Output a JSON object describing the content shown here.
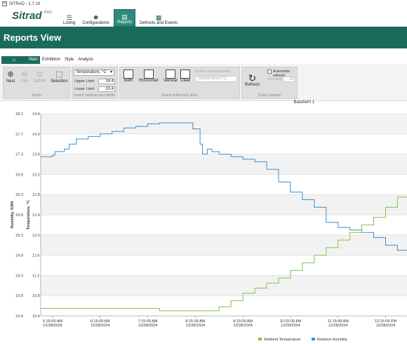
{
  "window": {
    "title": "SITRAD - 1.7.19"
  },
  "logo": {
    "brand": "Sitrad",
    "suffix": "PRO"
  },
  "topnav": {
    "items": [
      {
        "label": "Listing",
        "icon": "list-icon"
      },
      {
        "label": "Configurations",
        "icon": "gear-icon"
      },
      {
        "label": "Reports",
        "icon": "report-icon"
      },
      {
        "label": "Defrosts and Events",
        "icon": "calendar-icon"
      }
    ]
  },
  "header": {
    "title": "Reports View"
  },
  "tabs": {
    "home": "⌂",
    "items": [
      "Main",
      "Exhibition",
      "Style",
      "Analyze"
    ]
  },
  "ribbon": {
    "zoom": {
      "label": "Zoom",
      "next": "Next",
      "out": "Out",
      "pct": "100 %",
      "selection": "Selection"
    },
    "axis": {
      "label": "Insert vertical axis limits",
      "select": "Temperature, °C",
      "upper_label": "Upper Limit",
      "upper_value": "14.4",
      "lower_label": "Lower Limit",
      "lower_value": "10.4"
    },
    "reflines": {
      "label": "Insert reference lines",
      "both": "Both",
      "horizontal": "Horizontal",
      "vertical": "Vertical",
      "clear": "Clear",
      "select_label": "Select measurement",
      "select_value": "Temperature,°C"
    },
    "update": {
      "label": "Chart Update",
      "refresh": "Refresh",
      "auto": "Automatic refresh",
      "seconds_label": "Seconds",
      "seconds_value": "10"
    }
  },
  "sensor_label": "BalaSefri 1",
  "chart_data": {
    "type": "line",
    "ylabel_left": "Humidity, %RH",
    "ylabel_right": "Temperature, °C",
    "left_ticks": [
      "28.2",
      "27.7",
      "27.3",
      "26.8",
      "26.3",
      "25.8",
      "25.3",
      "24.8",
      "24.3",
      "23.8",
      "23.4"
    ],
    "right_ticks": [
      "14.4",
      "14.0",
      "13.6",
      "13.2",
      "12.8",
      "12.4",
      "12.0",
      "11.6",
      "11.2",
      "10.8",
      "10.4"
    ],
    "x_ticks": [
      {
        "time": "5:15:09 AM",
        "date": "12/28/2024"
      },
      {
        "time": "6:15:09 AM",
        "date": "12/28/2024"
      },
      {
        "time": "7:15:09 AM",
        "date": "12/28/2024"
      },
      {
        "time": "8:15:09 AM",
        "date": "12/28/2024"
      },
      {
        "time": "9:15:09 AM",
        "date": "12/28/2024"
      },
      {
        "time": "10:15:09 AM",
        "date": "12/28/2024"
      },
      {
        "time": "11:15:09 AM",
        "date": "12/28/2024"
      },
      {
        "time": "12:15:09 PM",
        "date": "12/28/2024"
      }
    ],
    "ylim_right": [
      10.4,
      14.4
    ],
    "series": [
      {
        "name": "Relative Humidity",
        "color": "#3a8ec8",
        "x_hours": [
          5.0,
          5.25,
          5.3,
          5.5,
          5.6,
          5.75,
          6.0,
          6.25,
          6.5,
          6.75,
          7.0,
          7.25,
          7.5,
          7.75,
          8.0,
          8.2,
          8.35,
          8.4,
          8.5,
          8.6,
          8.75,
          9.0,
          9.25,
          9.5,
          9.75,
          10.0,
          10.25,
          10.5,
          10.75,
          11.0,
          11.25,
          11.5,
          11.75,
          12.0,
          12.25,
          12.5,
          12.75
        ],
        "values": [
          13.55,
          13.58,
          13.65,
          13.7,
          13.8,
          13.9,
          13.95,
          14.0,
          14.05,
          14.12,
          14.15,
          14.2,
          14.22,
          14.22,
          14.22,
          14.1,
          13.8,
          13.6,
          13.7,
          13.65,
          13.6,
          13.55,
          13.5,
          13.45,
          13.3,
          13.05,
          12.85,
          12.7,
          12.55,
          12.25,
          12.15,
          12.1,
          12.05,
          11.95,
          11.8,
          11.7,
          11.7
        ]
      },
      {
        "name": "Ambient Temperature",
        "color": "#7cc24a",
        "x_hours": [
          5.0,
          6.0,
          7.0,
          7.5,
          8.0,
          8.5,
          8.75,
          9.0,
          9.25,
          9.5,
          9.75,
          10.0,
          10.25,
          10.5,
          10.75,
          11.0,
          11.25,
          11.5,
          11.75,
          12.0,
          12.25,
          12.5,
          12.75
        ],
        "values": [
          10.55,
          10.55,
          10.55,
          10.5,
          10.5,
          10.5,
          10.58,
          10.7,
          10.85,
          10.95,
          11.05,
          11.15,
          11.3,
          11.45,
          11.6,
          11.75,
          11.9,
          12.05,
          12.2,
          12.35,
          12.55,
          12.75,
          12.95
        ]
      }
    ]
  }
}
